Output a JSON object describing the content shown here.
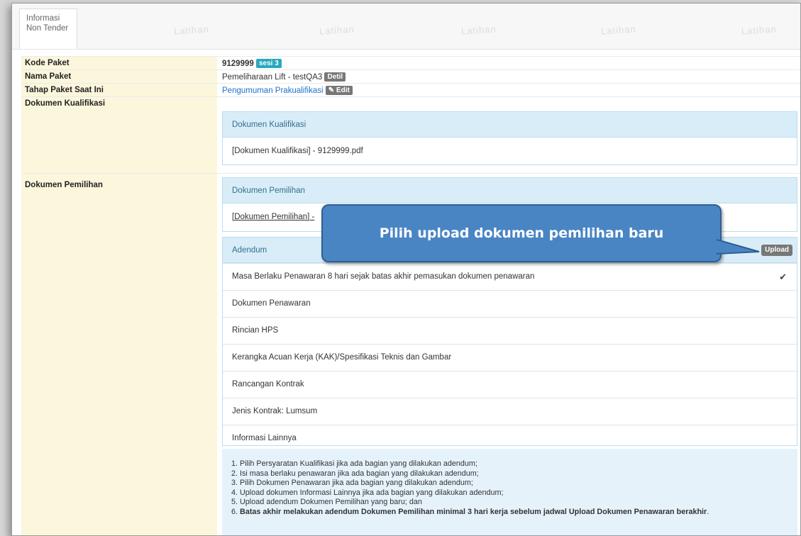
{
  "tab": {
    "line1": "Informasi",
    "line2": "Non Tender"
  },
  "watermark": "Latihan",
  "fields": {
    "kode_paket": {
      "label": "Kode Paket",
      "value": "9129999",
      "badge": "sesi 3"
    },
    "nama_paket": {
      "label": "Nama Paket",
      "value": "Pemeliharaan Lift - testQA3",
      "button": "Detil"
    },
    "tahap_paket": {
      "label": "Tahap Paket Saat Ini",
      "value": "Pengumuman Prakualifikasi",
      "button": "Edit"
    },
    "dokumen_kualifikasi": {
      "label": "Dokumen Kualifikasi"
    },
    "dokumen_pemilihan": {
      "label": "Dokumen Pemilihan"
    }
  },
  "kualifikasi_panel": {
    "title": "Dokumen Kualifikasi",
    "file": "[Dokumen Kualifikasi] - 9129999.pdf"
  },
  "pemilihan_panel": {
    "title": "Dokumen Pemilihan",
    "file": "[Dokumen Pemilihan] -"
  },
  "adendum": {
    "title": "Adendum",
    "upload_label": "Upload",
    "items": [
      "Masa Berlaku Penawaran 8 hari sejak batas akhir pemasukan dokumen penawaran",
      "Dokumen Penawaran",
      "Rincian HPS",
      "Kerangka Acuan Kerja (KAK)/Spesifikasi Teknis dan Gambar",
      "Rancangan Kontrak",
      "Jenis Kontrak: Lumsum",
      "Informasi Lainnya"
    ],
    "checked_index": 0
  },
  "notes": [
    "1. Pilih Persyaratan Kualifikasi jika ada bagian yang dilakukan adendum;",
    "2. Isi masa berlaku penawaran jika ada bagian yang dilakukan adendum;",
    "3. Pilih Dokumen Penawaran jika ada bagian yang dilakukan adendum;",
    "4. Upload dokumen Informasi Lainnya jika ada bagian yang dilakukan adendum;",
    "5. Upload adendum Dokumen Pemilihan yang baru; dan"
  ],
  "note6": {
    "prefix": "6. ",
    "bold": "Batas akhir melakukan adendum Dokumen Pemilihan minimal 3 hari kerja sebelum jadwal Upload Dokumen Penawaran berakhir",
    "suffix": "."
  },
  "callout": "Pilih upload dokumen pemilihan baru",
  "colors": {
    "callout": "#4a85c3",
    "panel_header": "#d9edf8",
    "label_bg": "#fbf6dc",
    "badge_teal": "#28a9bd"
  }
}
